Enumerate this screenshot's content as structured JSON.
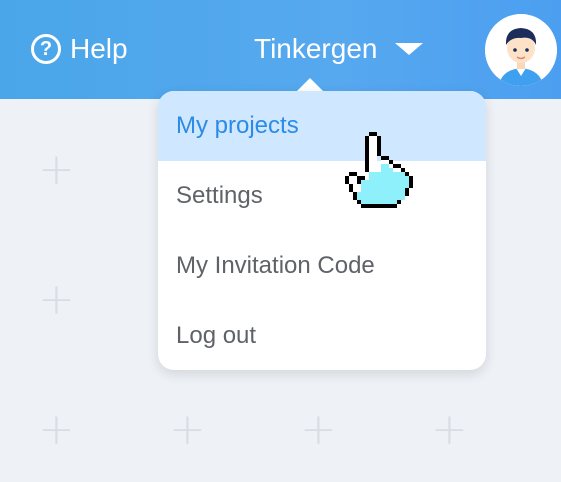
{
  "header": {
    "help_label": "Help",
    "help_icon": "question-circle-icon",
    "username": "Tinkergen",
    "caret_icon": "caret-down-icon",
    "avatar_icon": "user-avatar-icon"
  },
  "dropdown": {
    "items": [
      {
        "label": "My projects",
        "active": true
      },
      {
        "label": "Settings",
        "active": false
      },
      {
        "label": "My Invitation Code",
        "active": false
      },
      {
        "label": "Log out",
        "active": false
      }
    ]
  },
  "background": {
    "tile_icon": "plus-icon",
    "tile_glyph": "+"
  },
  "cursor": {
    "icon": "hand-pointer-cursor-icon"
  },
  "colors": {
    "header_blue": "#4aa6e9",
    "active_bg": "#cfe7ff",
    "active_text": "#2b8be6",
    "menu_text": "#5f6368"
  }
}
